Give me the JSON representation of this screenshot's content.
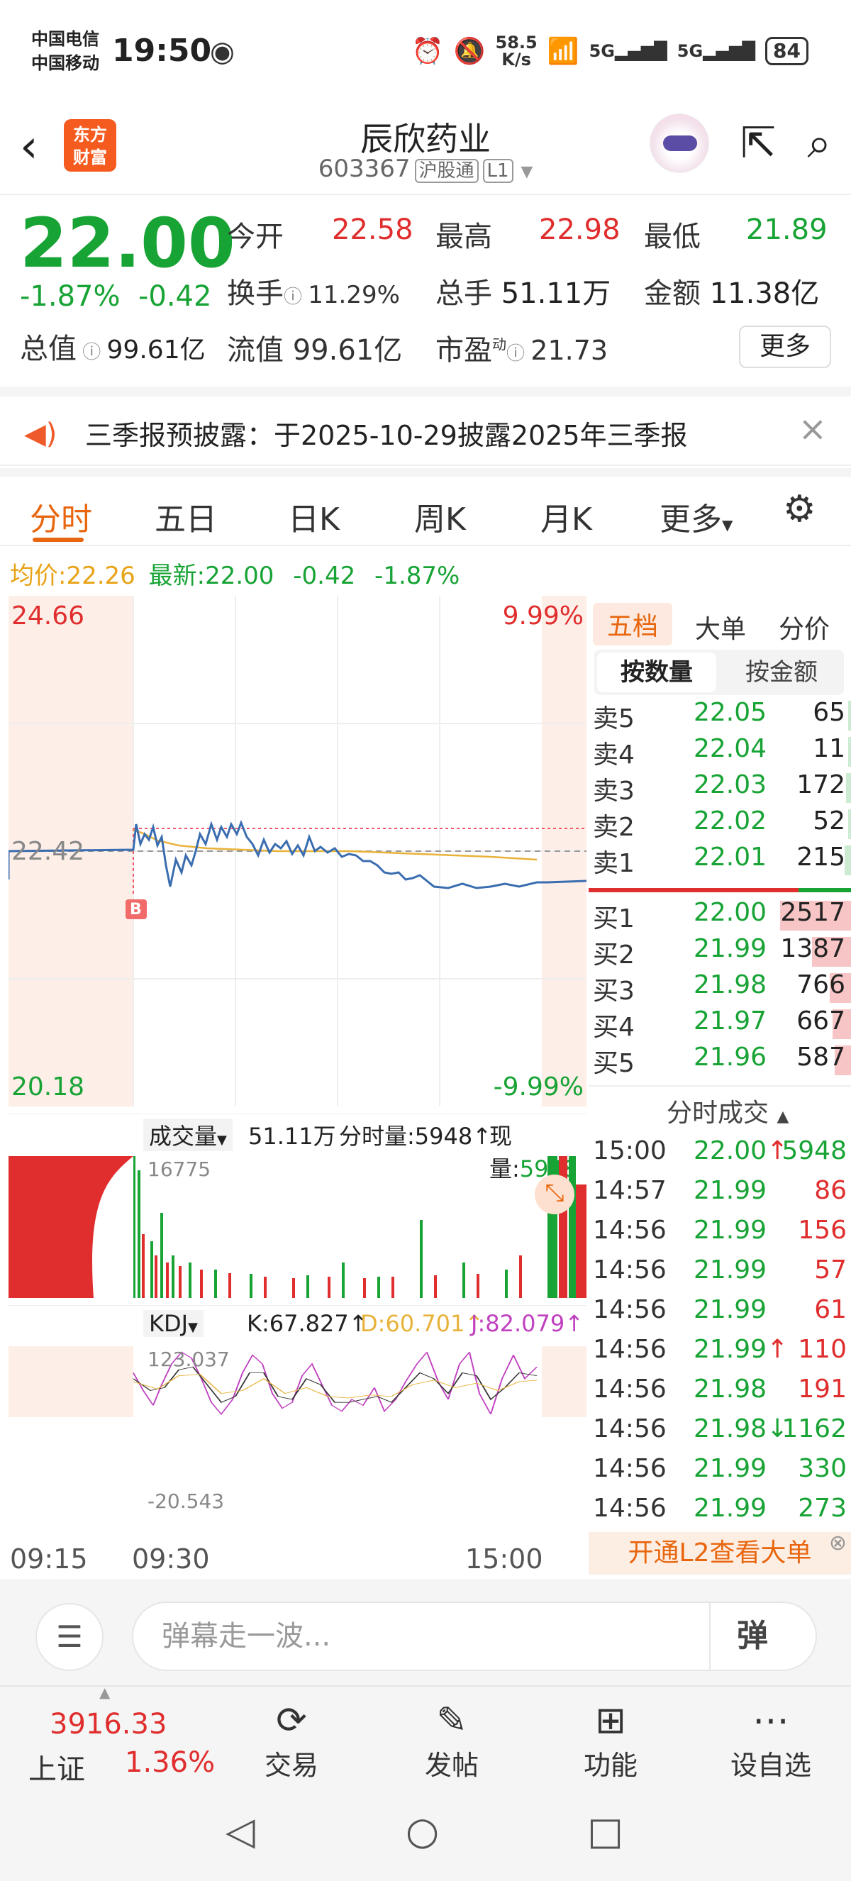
{
  "status": {
    "carrier1": "中国电信",
    "carrier2": "中国移动",
    "time": "19:50",
    "speed_value": "58.5",
    "speed_unit": "K/s",
    "net1": "5G",
    "net2": "5G",
    "battery": "84"
  },
  "header": {
    "logo_line1": "东方",
    "logo_line2": "财富",
    "stock_name": "辰欣药业",
    "stock_code": "603367",
    "tag1": "沪股通",
    "tag2": "L1"
  },
  "quote": {
    "price": "22.00",
    "change_pct": "-1.87%",
    "change": "-0.42",
    "open_label": "今开",
    "open": "22.58",
    "high_label": "最高",
    "high": "22.98",
    "low_label": "最低",
    "low": "21.89",
    "turnover_label": "换手",
    "turnover": "11.29%",
    "volume_label": "总手",
    "volume": "51.11万",
    "amount_label": "金额",
    "amount": "11.38亿",
    "mktcap_label": "总值",
    "mktcap": "99.61亿",
    "float_label": "流值",
    "float": "99.61亿",
    "pe_label": "市盈",
    "pe_sup": "动",
    "pe": "21.73",
    "more": "更多"
  },
  "notice": {
    "text": "三季报预披露：于2025-10-29披露2025年三季报"
  },
  "tabs": [
    "分时",
    "五日",
    "日K",
    "周K",
    "月K",
    "更多"
  ],
  "avgline": {
    "avg_label": "均价:",
    "avg": "22.26",
    "latest_label": "最新:",
    "latest": "22.00",
    "chg": "-0.42",
    "pct": "-1.87%"
  },
  "chart_labels": {
    "ytop": "24.66",
    "ymid": "22.42",
    "ybot": "20.18",
    "pct_top": "9.99%",
    "pct_bot": "-9.99%",
    "b_marker": "B",
    "vol_title": "成交量",
    "vol_total": "51.11万",
    "vol_ticks": "分时量:5948↑",
    "vol_now_label": "现量:",
    "vol_now": "5948",
    "vol_max": "16775",
    "kdj_title": "KDJ",
    "k": "K:67.827↑",
    "d": "D:60.701↑",
    "j": "J:82.079↑",
    "kdj_max": "123.037",
    "kdj_min": "-20.543",
    "t_start": "09:15",
    "t_open": "09:30",
    "t_close": "15:00"
  },
  "orderbook": {
    "tabs": [
      "五档",
      "大单",
      "分价"
    ],
    "seg": [
      "按数量",
      "按金额"
    ],
    "asks": [
      {
        "name": "卖5",
        "price": "22.05",
        "qty": "65",
        "w": 0.03
      },
      {
        "name": "卖4",
        "price": "22.04",
        "qty": "11",
        "w": 0.01
      },
      {
        "name": "卖3",
        "price": "22.03",
        "qty": "172",
        "w": 0.07
      },
      {
        "name": "卖2",
        "price": "22.02",
        "qty": "52",
        "w": 0.02
      },
      {
        "name": "卖1",
        "price": "22.01",
        "qty": "215",
        "w": 0.09
      }
    ],
    "bids": [
      {
        "name": "买1",
        "price": "22.00",
        "qty": "2517",
        "w": 1.0
      },
      {
        "name": "买2",
        "price": "21.99",
        "qty": "1387",
        "w": 0.55
      },
      {
        "name": "买3",
        "price": "21.98",
        "qty": "766",
        "w": 0.3
      },
      {
        "name": "买4",
        "price": "21.97",
        "qty": "667",
        "w": 0.26
      },
      {
        "name": "买5",
        "price": "21.96",
        "qty": "587",
        "w": 0.23
      }
    ],
    "ticks_title": "分时成交",
    "ticks": [
      {
        "time": "15:00",
        "price": "22.00",
        "arrow": "↑",
        "vol": "5948",
        "color": "green"
      },
      {
        "time": "14:57",
        "price": "21.99",
        "arrow": "",
        "vol": "86",
        "color": "red"
      },
      {
        "time": "14:56",
        "price": "21.99",
        "arrow": "",
        "vol": "156",
        "color": "red"
      },
      {
        "time": "14:56",
        "price": "21.99",
        "arrow": "",
        "vol": "57",
        "color": "red"
      },
      {
        "time": "14:56",
        "price": "21.99",
        "arrow": "",
        "vol": "61",
        "color": "red"
      },
      {
        "time": "14:56",
        "price": "21.99",
        "arrow": "↑",
        "vol": "110",
        "color": "red"
      },
      {
        "time": "14:56",
        "price": "21.98",
        "arrow": "",
        "vol": "191",
        "color": "red"
      },
      {
        "time": "14:56",
        "price": "21.98",
        "arrow": "↓",
        "vol": "1162",
        "color": "green"
      },
      {
        "time": "14:56",
        "price": "21.99",
        "arrow": "",
        "vol": "330",
        "color": "green"
      },
      {
        "time": "14:56",
        "price": "21.99",
        "arrow": "",
        "vol": "273",
        "color": "green"
      }
    ],
    "l2": "开通L2查看大单"
  },
  "danmu": {
    "placeholder": "弹幕走一波...",
    "btn": "弹"
  },
  "nav": {
    "index_value": "3916.33",
    "index_name": "上证",
    "index_pct": "1.36%",
    "trade": "交易",
    "post": "发帖",
    "func": "功能",
    "watch": "设自选"
  }
}
